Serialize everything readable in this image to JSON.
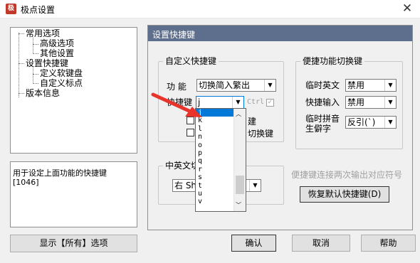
{
  "window": {
    "title": "极点设置",
    "app_icon_text": "极"
  },
  "tree": {
    "items": [
      {
        "label": "常用选项",
        "level": 0
      },
      {
        "label": "高级选项",
        "level": 1
      },
      {
        "label": "其他设置",
        "level": 1
      },
      {
        "label": "设置快捷键",
        "level": 0
      },
      {
        "label": "定义软键盘",
        "level": 1
      },
      {
        "label": "自定义标点",
        "level": 1
      },
      {
        "label": "版本信息",
        "level": 0
      }
    ]
  },
  "description": {
    "text": "用于设定上面功能的快捷键",
    "code": "[1046]"
  },
  "buttons": {
    "show_all": "显示【所有】选项",
    "ok": "确认",
    "cancel": "取消",
    "help": "帮助",
    "restore": "恢复默认快捷键(D)"
  },
  "panel": {
    "header": "设置快捷键",
    "custom_group": {
      "title": "自定义快捷键",
      "function_label": "功 能",
      "function_value": "切换简入繁出",
      "hotkey_label": "快捷键",
      "hotkey_value": "j",
      "ctrl_label": "Ctrl",
      "ctrl_checked": true,
      "check1_label": "建",
      "check2_label": "切换键"
    },
    "switch_group": {
      "title": "便捷功能切换键",
      "rows": [
        {
          "label": "临时英文",
          "value": "禁用"
        },
        {
          "label": "快捷输入",
          "value": "禁用"
        },
        {
          "label": "临时拼音\n生僻字",
          "value": "反引(`)"
        }
      ]
    },
    "zh_en_group": {
      "title": "中英文切",
      "value": "右 Sh"
    },
    "hint": "便捷键连接两次输出对应符号"
  },
  "dropdown": {
    "options": [
      "j",
      "k",
      "l",
      "n",
      "o",
      "p",
      "q",
      "r",
      "s",
      "t",
      "u",
      "v"
    ],
    "selected": "j"
  },
  "annotation": {
    "arrow_color": "#e8342a"
  }
}
